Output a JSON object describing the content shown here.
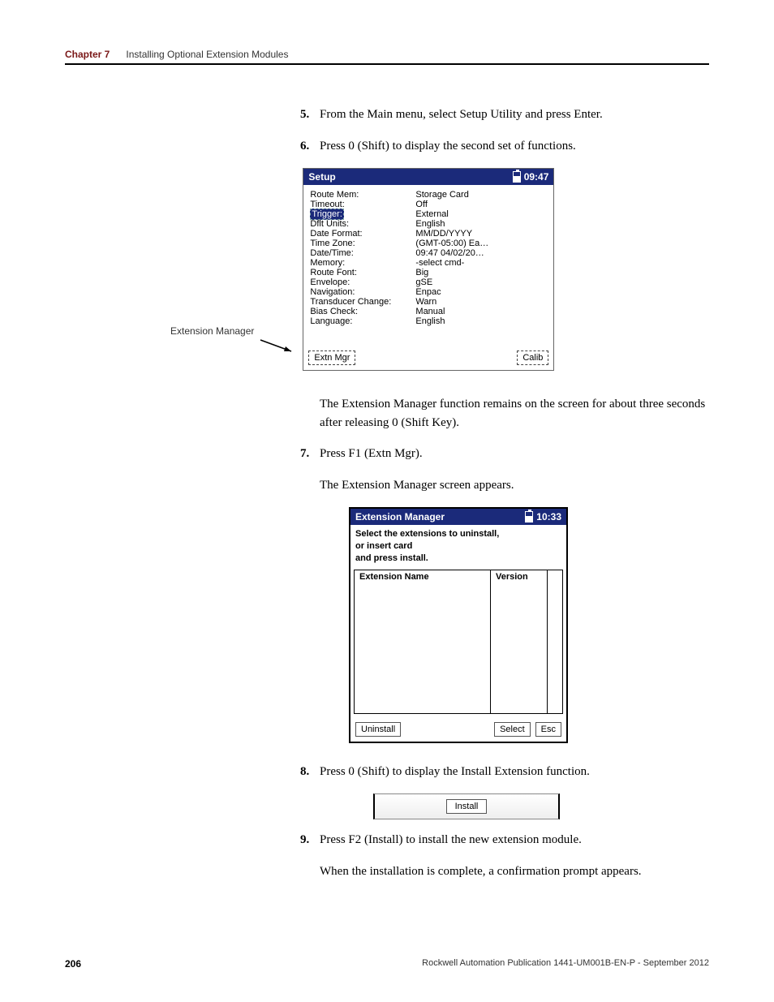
{
  "header": {
    "chapter": "Chapter 7",
    "title": "Installing Optional Extension Modules"
  },
  "steps": {
    "s5": {
      "num": "5.",
      "text": "From the Main menu, select Setup Utility and press Enter."
    },
    "s6": {
      "num": "6.",
      "text": "Press 0 (Shift) to display the second set of functions."
    },
    "s7": {
      "num": "7.",
      "text": "Press F1 (Extn Mgr)."
    },
    "s8": {
      "num": "8.",
      "text": "Press 0 (Shift) to display the Install Extension function."
    },
    "s9": {
      "num": "9.",
      "text": "Press F2 (Install) to install the new extension module."
    }
  },
  "para": {
    "p1": "The Extension Manager function remains on the screen for about three seconds after releasing 0 (Shift Key).",
    "p2": "The Extension Manager screen appears.",
    "p3": "When the installation is complete, a confirmation prompt appears."
  },
  "callout": {
    "ext_mgr": "Extension Manager"
  },
  "setup": {
    "title": "Setup",
    "time": "09:47",
    "rows": [
      {
        "k": "Route Mem:",
        "v": "Storage Card"
      },
      {
        "k": "Timeout:",
        "v": "Off"
      },
      {
        "k": "Trigger:",
        "v": "External",
        "selected": true
      },
      {
        "k": "Dflt Units:",
        "v": "English"
      },
      {
        "k": "Date Format:",
        "v": "MM/DD/YYYY"
      },
      {
        "k": "Time Zone:",
        "v": "(GMT-05:00) Ea…"
      },
      {
        "k": "Date/Time:",
        "v": "09:47 04/02/20…"
      },
      {
        "k": "Memory:",
        "v": "-select cmd-"
      },
      {
        "k": "Route Font:",
        "v": "Big"
      },
      {
        "k": "Envelope:",
        "v": "gSE"
      },
      {
        "k": "Navigation:",
        "v": "Enpac"
      },
      {
        "k": "Transducer Change:",
        "v": "Warn"
      },
      {
        "k": "Bias Check:",
        "v": "Manual"
      },
      {
        "k": "Language:",
        "v": "English"
      }
    ],
    "softkeys": {
      "left": "Extn Mgr",
      "right": "Calib"
    }
  },
  "extmgr": {
    "title": "Extension Manager",
    "time": "10:33",
    "instr1": "Select the extensions to uninstall,",
    "instr2": "or insert card",
    "instr3": "and press install.",
    "col1": "Extension Name",
    "col2": "Version",
    "softkeys": {
      "left": "Uninstall",
      "mid": "Select",
      "right": "Esc"
    }
  },
  "install": {
    "label": "Install"
  },
  "footer": {
    "page": "206",
    "pub": "Rockwell Automation Publication 1441-UM001B-EN-P - September 2012"
  }
}
